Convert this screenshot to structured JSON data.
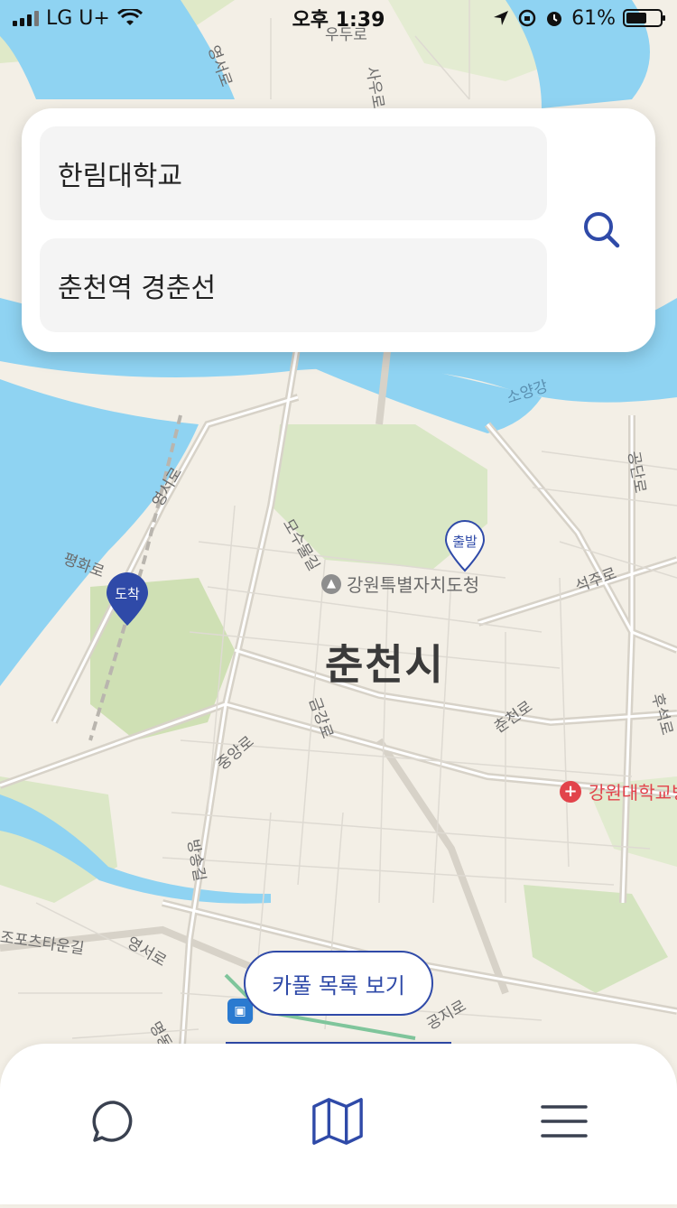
{
  "status_bar": {
    "carrier": "LG U+",
    "time": "오후 1:39",
    "battery_percent": "61%",
    "battery_level": 0.61,
    "icons": [
      "signal-icon",
      "wifi-icon",
      "location-arrow-icon",
      "orientation-lock-icon",
      "alarm-icon",
      "battery-icon"
    ]
  },
  "search": {
    "origin_value": "한림대학교",
    "destination_value": "춘천역 경춘선",
    "search_icon": "search-icon"
  },
  "map": {
    "city_label": "춘천시",
    "government_label": "강원특별자치도청",
    "hospital_label": "강원대학교병",
    "river_label": "소양강",
    "road_labels": [
      "우두로",
      "영서로",
      "사우로",
      "공단로",
      "석주로",
      "모수물길",
      "평화로",
      "영서로",
      "금강로",
      "춘천로",
      "후석로",
      "공지로",
      "중앙로",
      "방송길",
      "영서로",
      "조포츠타운길",
      "명동길"
    ],
    "start_pin_label": "출발",
    "end_pin_label": "도착",
    "accent_color": "#2f4aa8"
  },
  "carpool_button": {
    "label": "카풀 목록 보기"
  },
  "bottom_nav": {
    "items": [
      {
        "icon": "chat-bubble-icon",
        "active": false
      },
      {
        "icon": "map-icon",
        "active": true
      },
      {
        "icon": "menu-icon",
        "active": false
      }
    ]
  }
}
